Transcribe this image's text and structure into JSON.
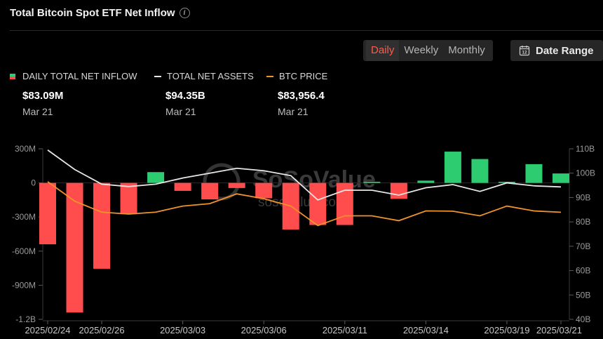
{
  "header": {
    "title": "Total Bitcoin Spot ETF Net Inflow",
    "info_icon": "info-icon"
  },
  "controls": {
    "periods": [
      "Daily",
      "Weekly",
      "Monthly"
    ],
    "active_period": "Daily",
    "date_range_label": "Date Range",
    "date_range_icon": "calendar-icon",
    "calendar_day": "12"
  },
  "legend": [
    {
      "label": "DAILY TOTAL NET INFLOW",
      "value": "$83.09M",
      "date": "Mar 21"
    },
    {
      "label": "TOTAL NET ASSETS",
      "value": "$94.35B",
      "date": "Mar 21"
    },
    {
      "label": "BTC PRICE",
      "value": "$83,956.4",
      "date": "Mar 21"
    }
  ],
  "watermark": {
    "brand": "SoSoValue",
    "site": "sosovalue.com"
  },
  "colors": {
    "positive": "#2ecc71",
    "negative": "#ff4d4d",
    "assets_line": "#e6e6e6",
    "price_line": "#f0922b",
    "active_tab": "#ff5a4a"
  },
  "chart_data": {
    "type": "bar",
    "x_tick_labels": [
      "2025/02/24",
      "2025/02/26",
      "2025/03/03",
      "2025/03/06",
      "2025/03/11",
      "2025/03/14",
      "2025/03/19",
      "2025/03/21"
    ],
    "categories": [
      "2025/02/24",
      "2025/02/25",
      "2025/02/26",
      "2025/02/27",
      "2025/02/28",
      "2025/03/03",
      "2025/03/04",
      "2025/03/05",
      "2025/03/06",
      "2025/03/07",
      "2025/03/10",
      "2025/03/11",
      "2025/03/12",
      "2025/03/13",
      "2025/03/14",
      "2025/03/17",
      "2025/03/18",
      "2025/03/19",
      "2025/03/20",
      "2025/03/21"
    ],
    "series": [
      {
        "name": "DAILY TOTAL NET INFLOW",
        "unit": "USD millions",
        "values": [
          -540,
          -1140,
          -755,
          -275,
          95,
          -70,
          -145,
          -45,
          -135,
          -410,
          -370,
          -370,
          10,
          -140,
          20,
          275,
          210,
          10,
          165,
          83.09
        ]
      },
      {
        "name": "TOTAL NET ASSETS",
        "unit": "USD billions",
        "axis": "right",
        "values": [
          109.5,
          101.5,
          95.5,
          94.5,
          95.5,
          98,
          100,
          102,
          101,
          99,
          89,
          93,
          93,
          91,
          94,
          95.3,
          92.5,
          96,
          94.8,
          94.35
        ]
      },
      {
        "name": "BTC PRICE",
        "unit": "USD",
        "axis": "right",
        "values": [
          96500,
          88500,
          84000,
          83200,
          84000,
          86500,
          87500,
          91500,
          89500,
          86500,
          78500,
          82500,
          82500,
          80500,
          84500,
          84400,
          82500,
          86500,
          84500,
          83956.4
        ]
      }
    ],
    "y_left": {
      "ticks": [
        300,
        0,
        -300,
        -600,
        -900,
        -1200
      ],
      "tick_labels": [
        "300M",
        "0",
        "-300M",
        "-600M",
        "-900M",
        "-1.2B"
      ],
      "lim": [
        -1200,
        300
      ]
    },
    "y_right": {
      "ticks": [
        110,
        100,
        90,
        80,
        70,
        60,
        50,
        40
      ],
      "tick_labels": [
        "110B",
        "100B",
        "90B",
        "80B",
        "70B",
        "60B",
        "50B",
        "40B"
      ],
      "lim": [
        40,
        110
      ]
    },
    "legend_position": "top-left",
    "grid": false
  }
}
